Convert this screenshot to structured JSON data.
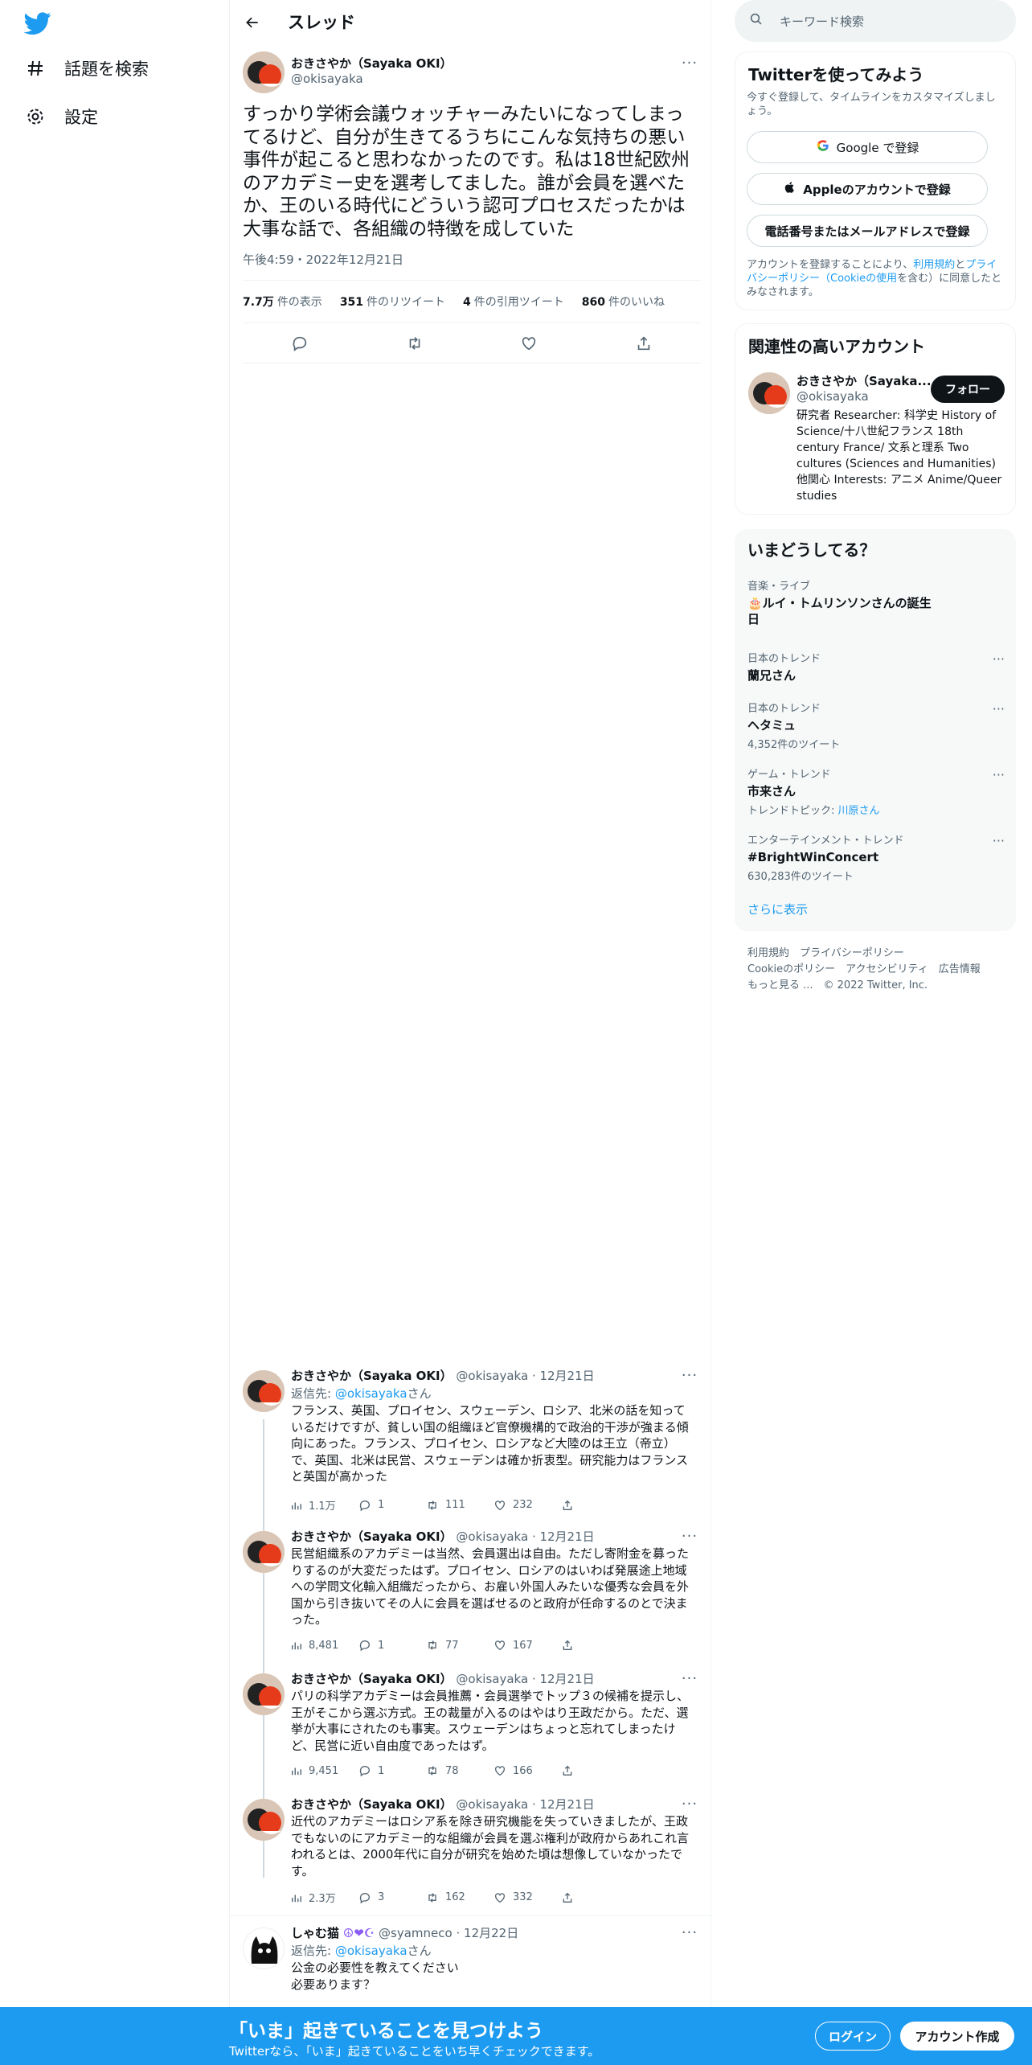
{
  "nav": {
    "explore_label": "話題を検索",
    "settings_label": "設定"
  },
  "header": {
    "title": "スレッド"
  },
  "tweet": {
    "display_name": "おきさやか（Sayaka OKI）",
    "handle": "@okisayaka",
    "text": "すっかり学術会議ウォッチャーみたいになってしまってるけど、自分が生きてるうちにこんな気持ちの悪い事件が起こると思わなかったのです。私は18世紀欧州のアカデミー史を選考してました。誰が会員を選べたか、王のいる時代にどういう認可プロセスだったかは大事な話で、各組織の特徴を成していた",
    "timestamp": "午後4:59・2022年12月21日",
    "views_count": "7.7万",
    "views_label": "件の表示",
    "retweets_count": "351",
    "retweets_label": "件のリツイート",
    "quotes_count": "4",
    "quotes_label": "件の引用ツイート",
    "likes_count": "860",
    "likes_label": "件のいいね"
  },
  "replies": [
    {
      "display_name": "おきさやか（Sayaka OKI）",
      "handle": "@okisayaka",
      "date": "· 12月21日",
      "reply_prefix": "返信先: ",
      "reply_to": "@okisayaka",
      "reply_suffix": "さん",
      "text": "フランス、英国、プロイセン、スウェーデン、ロシア、北米の話を知っているだけですが、貧しい国の組織ほど官僚機構的で政治的干渉が強まる傾向にあった。フランス、プロイセン、ロシアなど大陸のは王立（帝立）で、英国、北米は民営、スウェーデンは確か折衷型。研究能力はフランスと英国が高かった",
      "views": "1.1万",
      "replies": "1",
      "retweets": "111",
      "likes": "232"
    },
    {
      "display_name": "おきさやか（Sayaka OKI）",
      "handle": "@okisayaka",
      "date": "· 12月21日",
      "text": "民営組織系のアカデミーは当然、会員選出は自由。ただし寄附金を募ったりするのが大変だったはず。プロイセン、ロシアのはいわば発展途上地域への学問文化輸入組織だったから、お雇い外国人みたいな優秀な会員を外国から引き抜いてその人に会員を選ばせるのと政府が任命するのとで決まった。",
      "views": "8,481",
      "replies": "1",
      "retweets": "77",
      "likes": "167"
    },
    {
      "display_name": "おきさやか（Sayaka OKI）",
      "handle": "@okisayaka",
      "date": "· 12月21日",
      "text": "パリの科学アカデミーは会員推薦・会員選挙でトップ３の候補を提示し、王がそこから選ぶ方式。王の裁量が入るのはやはり王政だから。ただ、選挙が大事にされたのも事実。スウェーデンはちょっと忘れてしまったけど、民営に近い自由度であったはず。",
      "views": "9,451",
      "replies": "1",
      "retweets": "78",
      "likes": "166"
    },
    {
      "display_name": "おきさやか（Sayaka OKI）",
      "handle": "@okisayaka",
      "date": "· 12月21日",
      "text": "近代のアカデミーはロシア系を除き研究機能を失っていきましたが、王政でもないのにアカデミー的な組織が会員を選ぶ権利が政府からあれこれ言われるとは、2000年代に自分が研究を始めた頃は想像していなかったです。",
      "views": "2.3万",
      "replies": "3",
      "retweets": "162",
      "likes": "332"
    },
    {
      "display_name": "しゃむ猫",
      "handle": "@syamneco",
      "date": "· 12月22日",
      "reply_prefix": "返信先: ",
      "reply_to": "@okisayaka",
      "reply_suffix": "さん",
      "text": "公金の必要性を教えてください\n必要あります？"
    }
  ],
  "sidebar": {
    "search_placeholder": "キーワード検索",
    "signup_card": {
      "title": "Twitterを使ってみよう",
      "subtitle": "今すぐ登録して、タイムラインをカスタマイズしましょう。",
      "google_label": "Google で登録",
      "apple_label": "Appleのアカウントで登録",
      "phone_label": "電話番号またはメールアドレスで登録",
      "terms_pre": "アカウントを登録することにより、",
      "terms_link": "利用規約",
      "terms_mid": "と",
      "privacy_link": "プライバシーポリシー",
      "cookie_link": "（Cookieの使用",
      "terms_post": "を含む）に同意したとみなされます。"
    },
    "relevant": {
      "title": "関連性の高いアカウント",
      "name": "おきさやか（Sayaka...",
      "handle": "@okisayaka",
      "follow_label": "フォロー",
      "bio": "研究者 Researcher: 科学史 History of Science/十八世紀フランス 18th century France/ 文系と理系 Two cultures (Sciences and Humanities) 他関心 Interests: アニメ Anime/Queer studies"
    },
    "trends_title": "いまどうしてる？",
    "trends": [
      {
        "category": "音楽・ライブ",
        "name": "🎂ルイ・トムリンソンさんの誕生日",
        "count": ""
      },
      {
        "category": "日本のトレンド",
        "name": "蘭兄さん",
        "count": ""
      },
      {
        "category": "日本のトレンド",
        "name": "ヘタミュ",
        "count": "4,352件のツイート"
      },
      {
        "category": "ゲーム・トレンド",
        "name": "市来さん",
        "count": "トレンドトピック: ",
        "count_link": "川原さん"
      },
      {
        "category": "エンターテインメント・トレンド",
        "name": "#BrightWinConcert",
        "count": "630,283件のツイート"
      }
    ],
    "show_more": "さらに表示",
    "footer": {
      "line1": "利用規約　プライバシーポリシー",
      "line2": "Cookieのポリシー　アクセシビリティ　広告情報",
      "line3": "もっと見る ...　© 2022 Twitter, Inc."
    }
  },
  "banner": {
    "title": "「いま」起きていることを見つけよう",
    "subtitle": "Twitterなら、「いま」起きていることをいち早くチェックできます。",
    "login_label": "ログイン",
    "signup_label": "アカウント作成"
  },
  "colors": {
    "accent": "#1d9bf0",
    "text": "#0f1419",
    "muted": "#536471"
  }
}
